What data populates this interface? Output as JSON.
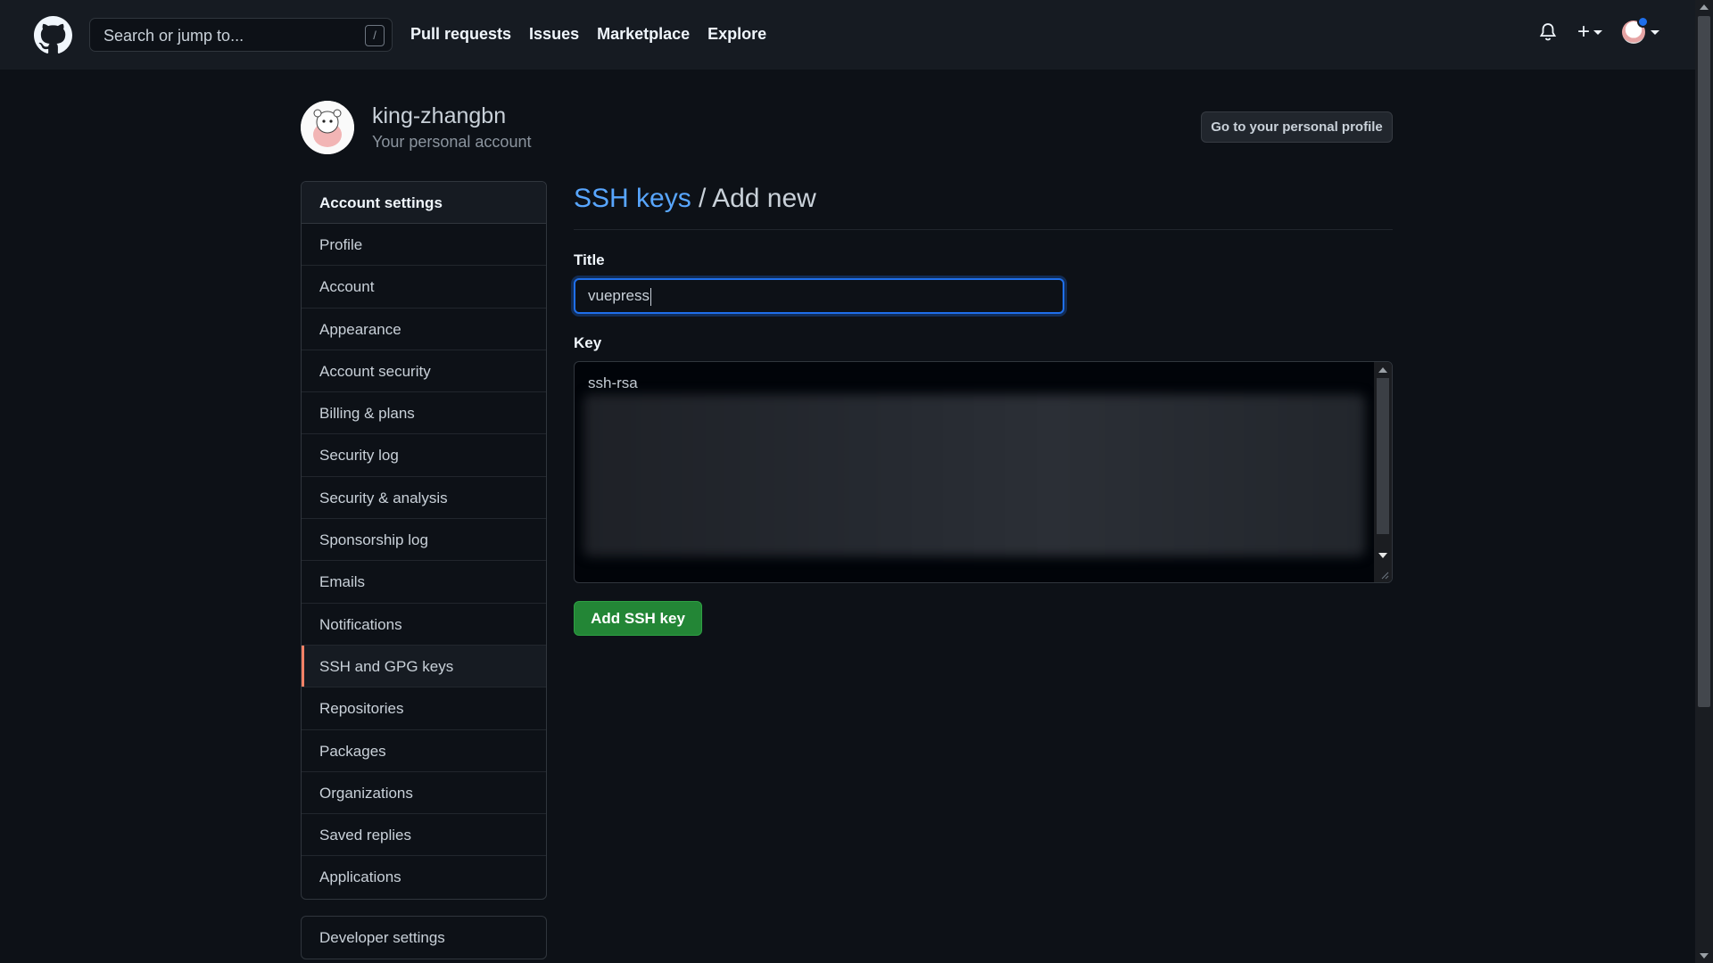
{
  "header": {
    "search_placeholder": "Search or jump to...",
    "search_shortcut": "/",
    "nav": [
      "Pull requests",
      "Issues",
      "Marketplace",
      "Explore"
    ],
    "plus_label": "+"
  },
  "account": {
    "username": "king-zhangbn",
    "subtitle": "Your personal account",
    "profile_button": "Go to your personal profile"
  },
  "sidebar": {
    "heading": "Account settings",
    "items": [
      "Profile",
      "Account",
      "Appearance",
      "Account security",
      "Billing & plans",
      "Security log",
      "Security & analysis",
      "Sponsorship log",
      "Emails",
      "Notifications",
      "SSH and GPG keys",
      "Repositories",
      "Packages",
      "Organizations",
      "Saved replies",
      "Applications"
    ],
    "active_item": "SSH and GPG keys",
    "developer_settings": "Developer settings"
  },
  "main": {
    "breadcrumb_link": "SSH keys",
    "breadcrumb_sep": " / ",
    "breadcrumb_current": "Add new",
    "title_label": "Title",
    "title_value": "vuepress",
    "key_label": "Key",
    "key_value": "ssh-rsa",
    "submit_label": "Add SSH key"
  },
  "colors": {
    "accent_link": "#58a6ff",
    "active_marker": "#f78166",
    "primary_button": "#238636",
    "focus_ring": "#1f6feb"
  }
}
